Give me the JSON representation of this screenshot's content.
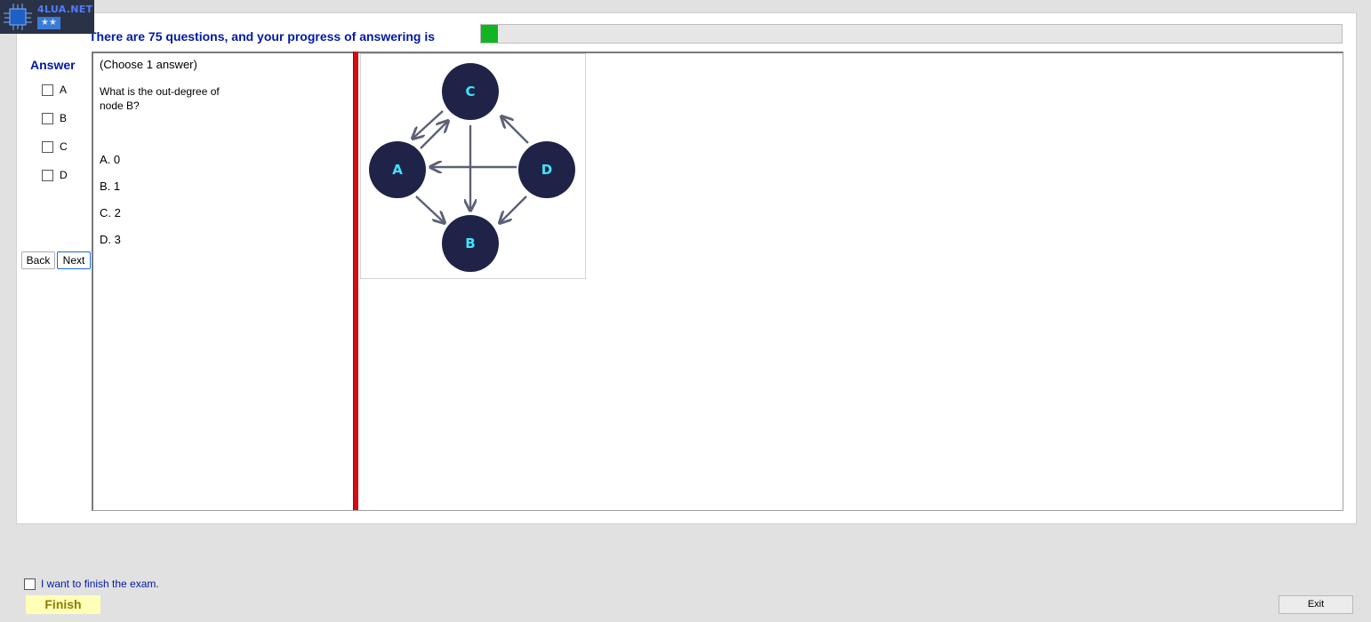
{
  "logo": {
    "brand": "4LUA.NET",
    "badge": "★★"
  },
  "header": {
    "progress_text": "There are 75 questions, and your progress of answering is",
    "progress_fraction": 0.02
  },
  "answer_panel": {
    "title": "Answer",
    "options": [
      "A",
      "B",
      "C",
      "D"
    ],
    "back_label": "Back",
    "next_label": "Next"
  },
  "question": {
    "hint": "(Choose 1 answer)",
    "text": "What is the out-degree of node B?",
    "answers": [
      "A.  0",
      "B.  1",
      "C.  2",
      "D.  3"
    ]
  },
  "graph": {
    "nodes": [
      "C",
      "A",
      "D",
      "B"
    ],
    "node_color": "#1f2347",
    "label_color": "#3fe6ff",
    "edge_color": "#5c6177"
  },
  "footer": {
    "finish_check_label": "I want to finish the exam.",
    "finish_label": "Finish",
    "exit_label": "Exit"
  }
}
